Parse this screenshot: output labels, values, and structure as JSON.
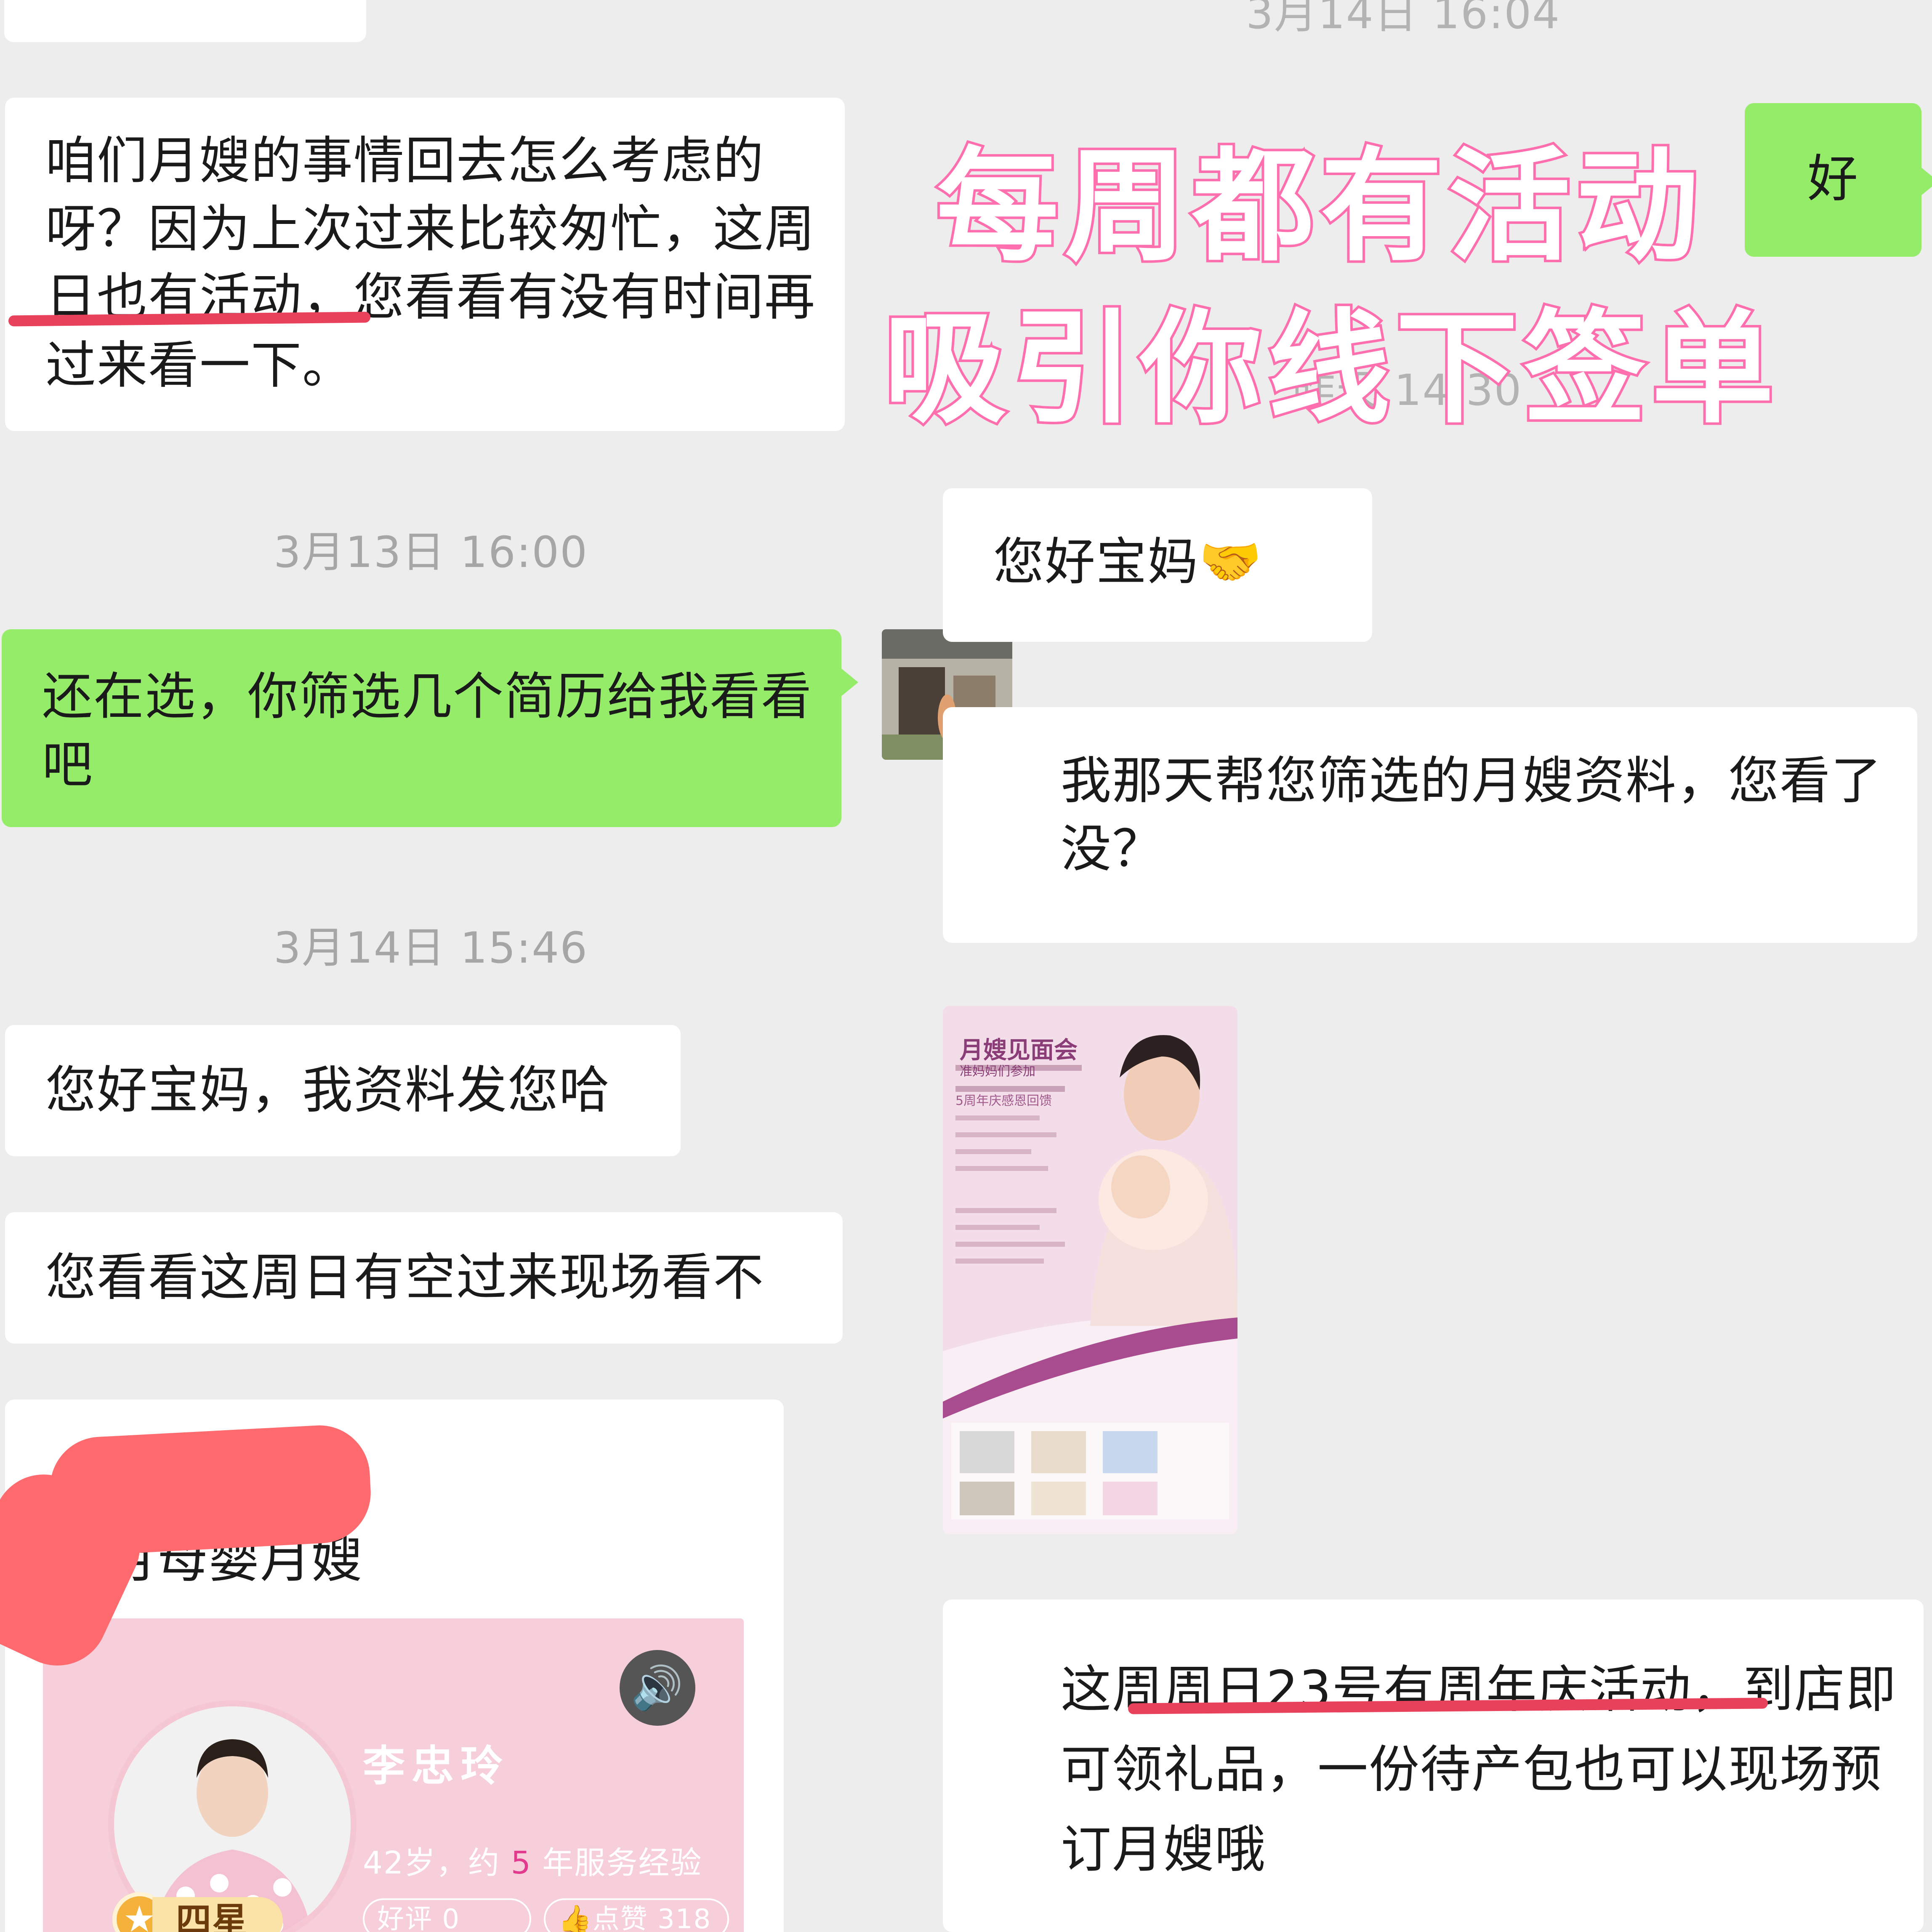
{
  "left": {
    "messages": [
      {
        "text": "咱们月嫂的事情回去怎么考虑的呀？因为上次过来比较匆忙，这周日也有活动，您看看有没有时间再过来看一下。"
      },
      {
        "time": "3月13日 16:00"
      },
      {
        "text": "还在选，你筛选几个简历给我看看吧"
      },
      {
        "time": "3月14日 15:46"
      },
      {
        "text": "您好宝妈，我资料发您哈"
      },
      {
        "text": "您看看这周日有空过来现场看不"
      }
    ],
    "card": {
      "title": "月母婴月嫂",
      "name": "李忠玲",
      "info_prefix": "42岁，约",
      "info_years": "5",
      "info_suffix": "年服务经验",
      "level": "四星月嫂",
      "good_reviews": "好评 0",
      "likes": "点赞 318"
    }
  },
  "right": {
    "time_top": "3月14日 16:04",
    "reply": "好",
    "time_yesterday": "昨天 14:30",
    "greeting": "您好宝妈",
    "greeting_emoji": "🤝",
    "question": "我那天帮您筛选的月嫂资料，您看了没？",
    "poster": {
      "title": "月嫂见面会",
      "subtitle": "准妈妈们参加",
      "tag": "5周年庆感恩回馈"
    },
    "event": "这周周日23号有周年庆活动，到店即可领礼品，一份待产包也可以现场预订月嫂哦"
  },
  "overlay": {
    "line1": "每周都有活动",
    "line2": "吸引你线下签单"
  },
  "colors": {
    "chat_bg": "#ededed",
    "sent_bubble": "#95ec69",
    "received_bubble": "#ffffff",
    "overlay_pink": "#ff6fae",
    "underline_red": "#e8415b"
  }
}
